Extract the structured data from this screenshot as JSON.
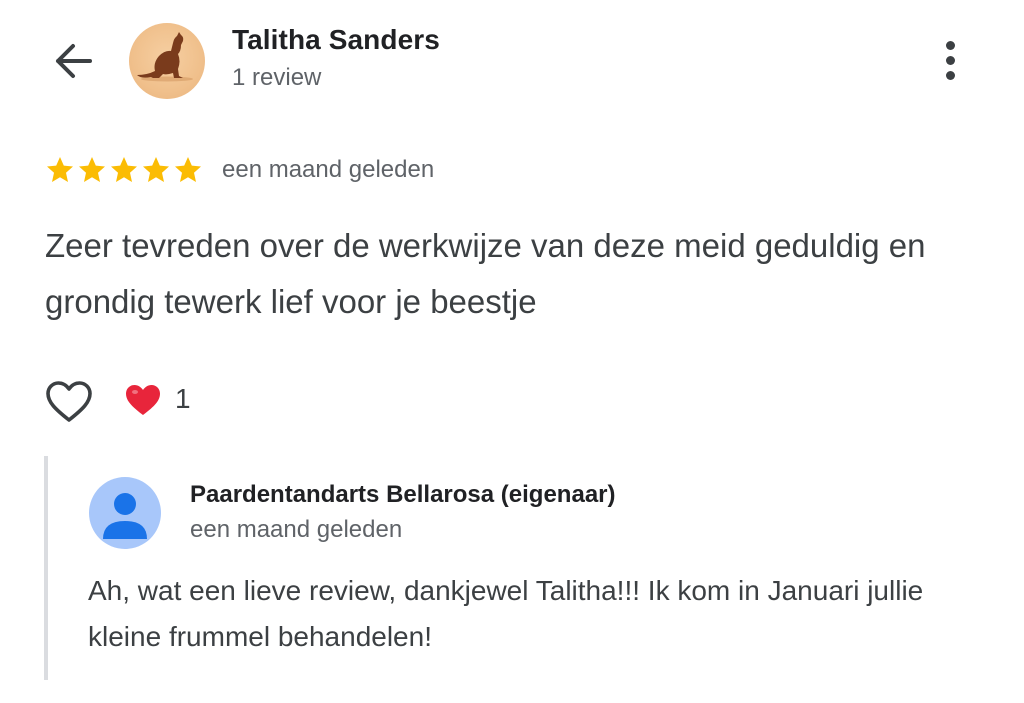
{
  "header": {
    "reviewer_name": "Talitha Sanders",
    "review_count": "1 review"
  },
  "review": {
    "rating": 5,
    "rating_max": 5,
    "star_color": "#fbbc04",
    "time": "een maand geleden",
    "text": "Zeer tevreden over de werkwijze van deze meid geduldig en grondig tewerk lief voor je beestje"
  },
  "reactions": {
    "heart_count": "1",
    "heart_color": "#e8253b"
  },
  "owner_reply": {
    "name": "Paardentandarts Bellarosa (eigenaar)",
    "time": "een maand geleden",
    "text": "Ah, wat een lieve review, dankjewel Talitha!!! Ik kom in Januari jullie kleine frummel behandelen!"
  },
  "icons": {
    "back": "back-arrow-icon",
    "more": "more-vert-icon",
    "like": "heart-outline-icon",
    "reaction": "heart-filled-icon",
    "owner_avatar": "person-icon"
  }
}
